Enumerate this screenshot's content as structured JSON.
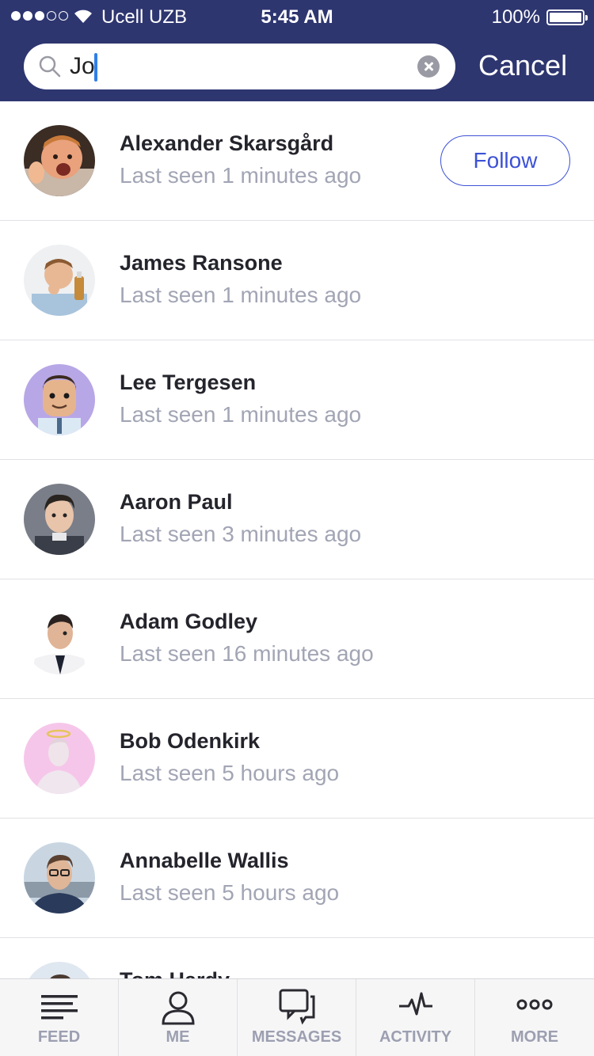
{
  "status_bar": {
    "carrier": "Ucell UZB",
    "time": "5:45 AM",
    "battery": "100%"
  },
  "search": {
    "value": "Jo",
    "cancel_label": "Cancel"
  },
  "results": [
    {
      "name": "Alexander Skarsgård",
      "seen": "Last seen 1 minutes ago",
      "action": "Follow"
    },
    {
      "name": "James Ransone",
      "seen": "Last seen 1 minutes ago"
    },
    {
      "name": "Lee Tergesen",
      "seen": "Last seen 1 minutes ago"
    },
    {
      "name": "Aaron Paul",
      "seen": "Last seen 3 minutes ago"
    },
    {
      "name": "Adam Godley",
      "seen": "Last seen 16 minutes ago"
    },
    {
      "name": "Bob Odenkirk",
      "seen": "Last seen 5 hours ago"
    },
    {
      "name": "Annabelle Wallis",
      "seen": "Last seen 5 hours ago"
    },
    {
      "name": "Tom Hardy",
      "seen": ""
    }
  ],
  "tabbar": [
    {
      "label": "FEED",
      "icon": "feed-icon"
    },
    {
      "label": "ME",
      "icon": "user-icon"
    },
    {
      "label": "MESSAGES",
      "icon": "messages-icon"
    },
    {
      "label": "ACTIVITY",
      "icon": "activity-icon"
    },
    {
      "label": "MORE",
      "icon": "more-icon"
    }
  ],
  "colors": {
    "header": "#2e3670",
    "accent": "#3d52d5",
    "muted": "#a2a5b4"
  }
}
